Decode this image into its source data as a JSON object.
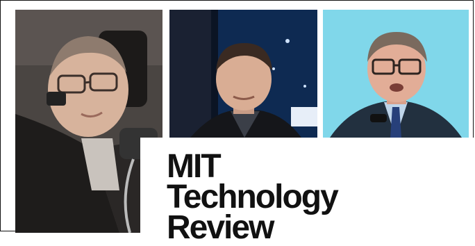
{
  "logo": {
    "line1": "MIT",
    "line2": "Technology",
    "line3": "Review"
  },
  "photos": [
    {
      "id": "person-left"
    },
    {
      "id": "person-center"
    },
    {
      "id": "person-right"
    }
  ],
  "colors": {
    "logo_text": "#111111",
    "right_photo_background": "#7fd6e8",
    "center_photo_background": "#0a1220"
  }
}
